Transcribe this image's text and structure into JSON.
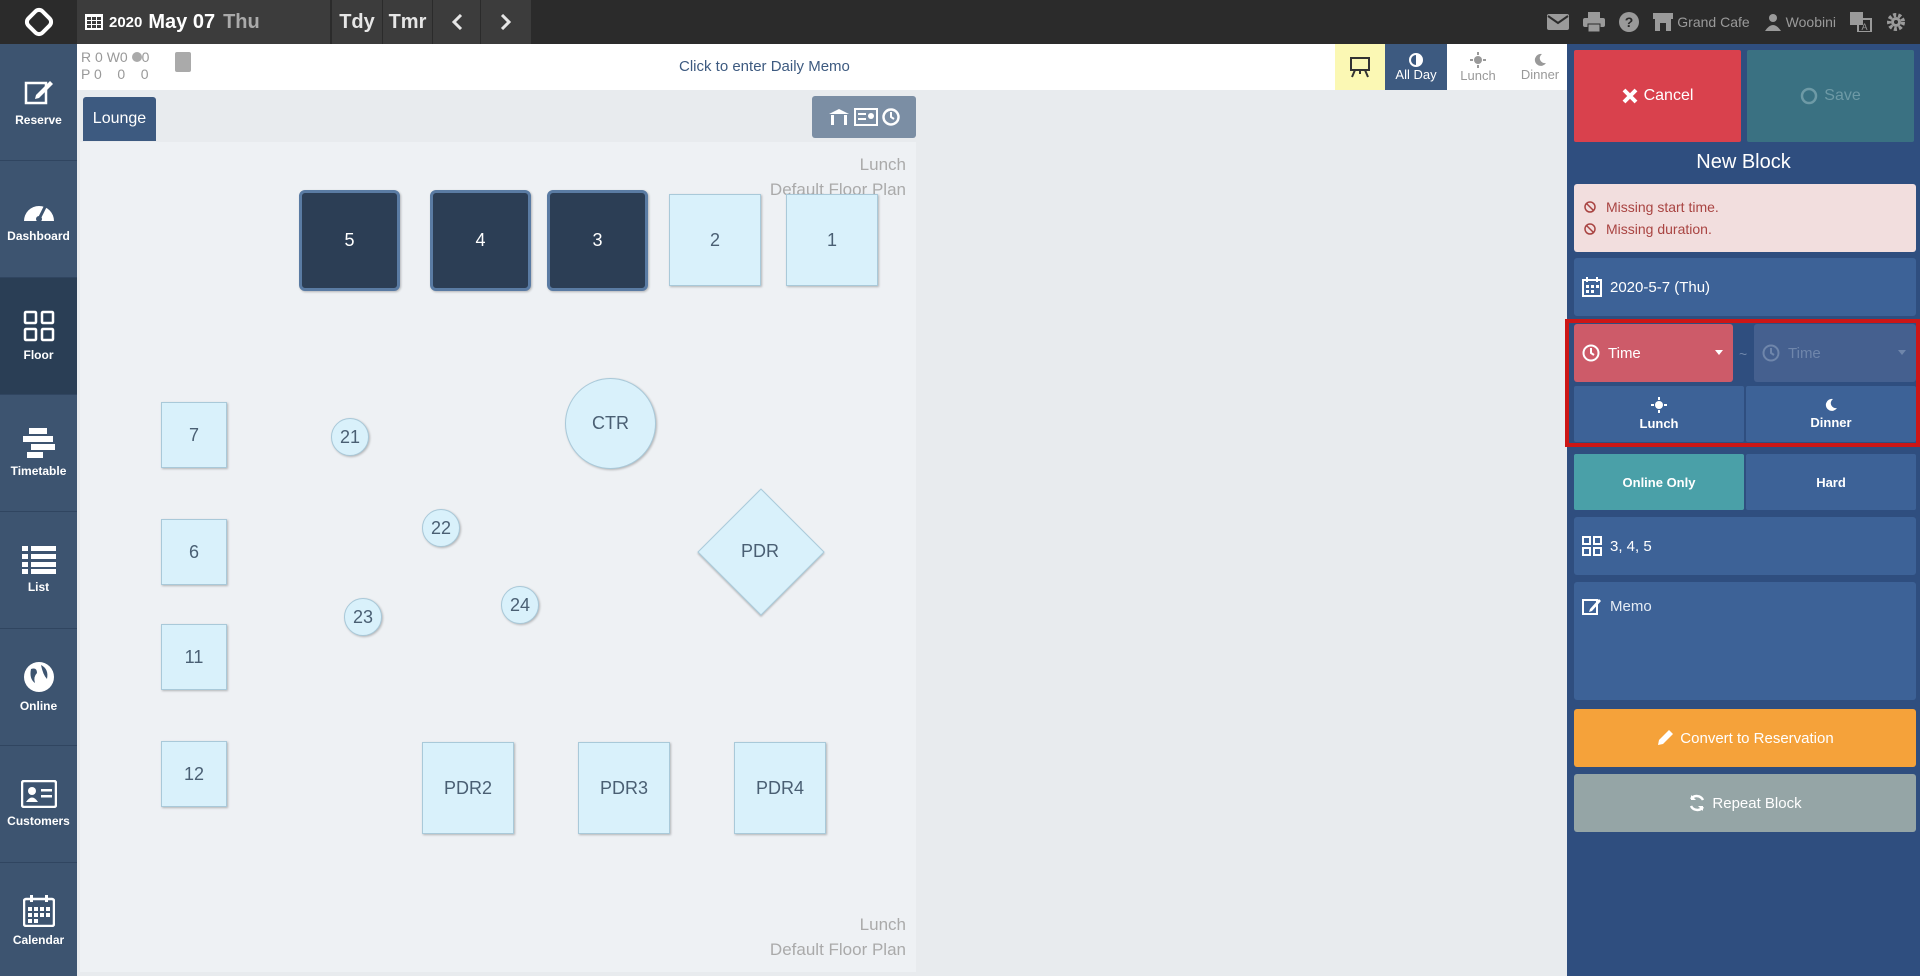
{
  "header": {
    "year": "2020",
    "month_day": "May 07",
    "weekday": "Thu",
    "today_label": "Tdy",
    "tomorrow_label": "Tmr",
    "restaurant": "Grand Cafe",
    "user": "Woobini"
  },
  "sidebar": {
    "items": [
      {
        "label": "Reserve",
        "icon": "edit-icon"
      },
      {
        "label": "Dashboard",
        "icon": "gauge-icon"
      },
      {
        "label": "Floor",
        "icon": "grid-icon"
      },
      {
        "label": "Timetable",
        "icon": "timetable-icon"
      },
      {
        "label": "List",
        "icon": "list-icon"
      },
      {
        "label": "Online",
        "icon": "globe-icon"
      },
      {
        "label": "Customers",
        "icon": "id-card-icon"
      },
      {
        "label": "Calendar",
        "icon": "calendar-icon"
      }
    ]
  },
  "memo_bar": {
    "r_label": "R",
    "r_values": [
      "0",
      "W",
      "0",
      "0"
    ],
    "p_label": "P",
    "p_values": [
      "0",
      "0",
      "0"
    ],
    "memo_prompt": "Click to enter Daily Memo",
    "shifts": [
      "All Day",
      "Lunch",
      "Dinner"
    ]
  },
  "floor": {
    "tab": "Lounge",
    "label_line1": "Lunch",
    "label_line2": "Default Floor Plan",
    "tables": {
      "t5": "5",
      "t4": "4",
      "t3": "3",
      "t2": "2",
      "t1": "1",
      "t7": "7",
      "t6": "6",
      "t11": "11",
      "t12": "12",
      "t21": "21",
      "t22": "22",
      "t23": "23",
      "t24": "24",
      "ctr": "CTR",
      "pdr": "PDR",
      "pdr2": "PDR2",
      "pdr3": "PDR3",
      "pdr4": "PDR4"
    }
  },
  "panel": {
    "cancel": "Cancel",
    "save": "Save",
    "title": "New Block",
    "errors": [
      "Missing start time.",
      "Missing duration."
    ],
    "date": "2020-5-7 (Thu)",
    "time_start": "Time",
    "time_end": "Time",
    "tilde": "~",
    "lunch": "Lunch",
    "dinner": "Dinner",
    "online_only": "Online Only",
    "hard": "Hard",
    "tables": "3,  4,  5",
    "memo": "Memo",
    "convert": "Convert to Reservation",
    "repeat": "Repeat Block"
  },
  "colors": {
    "cancel": "#d9414d",
    "convert": "#f5a23a",
    "repeat": "#95a5a6",
    "highlight": "#cc1616"
  }
}
